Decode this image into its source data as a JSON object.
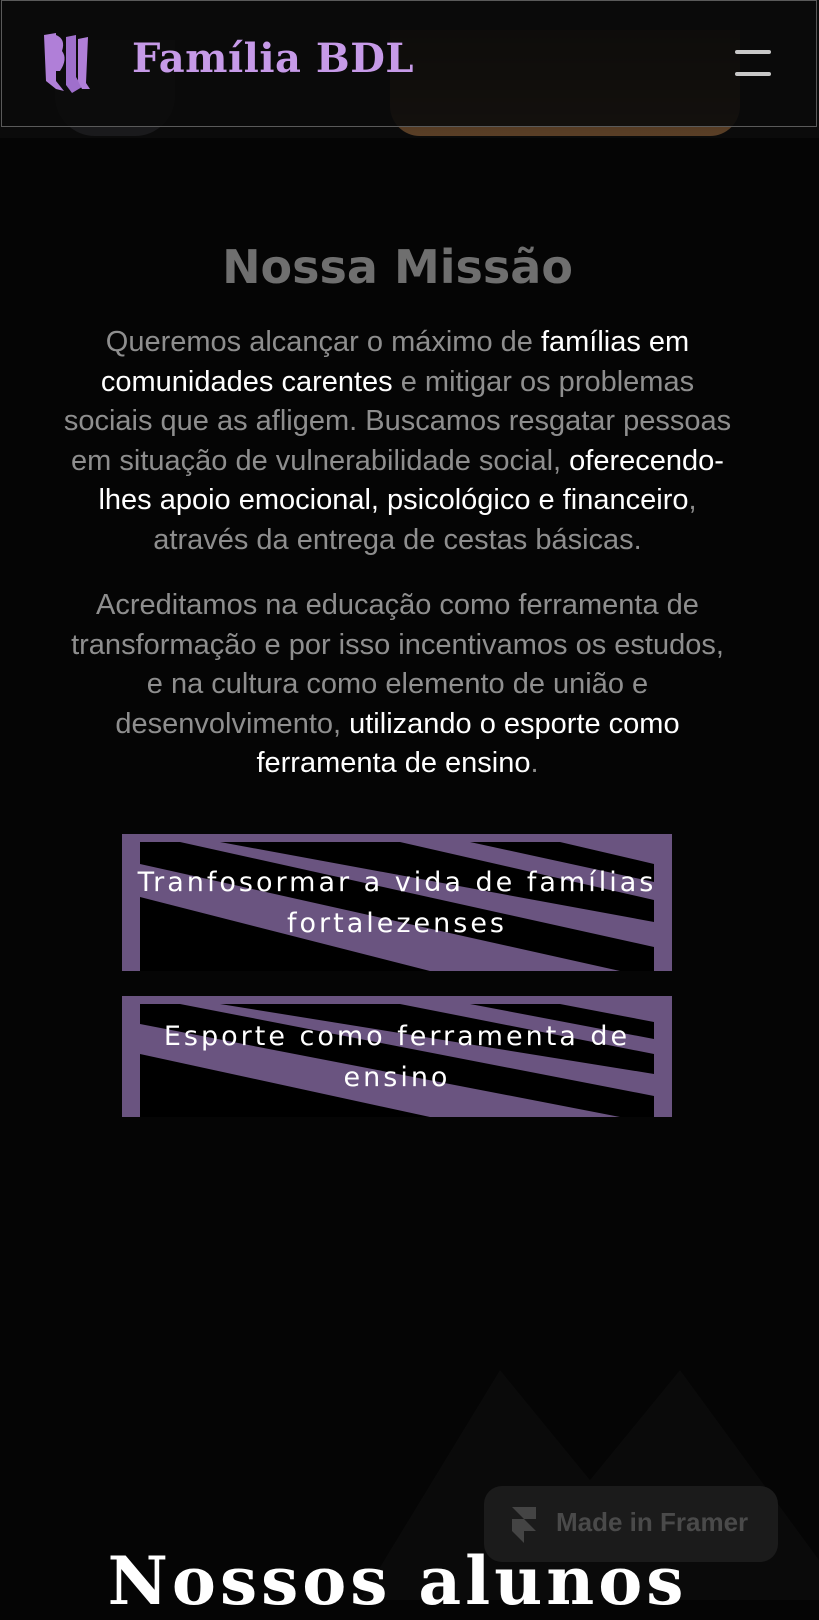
{
  "header": {
    "logo_alt": "BDL",
    "brand": "Família BDL",
    "menu_icon": "hamburger-menu-icon"
  },
  "mission": {
    "title": "Nossa Missão",
    "p1": [
      {
        "text": "Queremos alcançar o máximo de ",
        "highlight": false
      },
      {
        "text": "famílias em comunidades carentes",
        "highlight": true
      },
      {
        "text": " e mitigar os problemas sociais que as afligem. Buscamos resgatar pessoas em situação de vulnerabilidade social, ",
        "highlight": false
      },
      {
        "text": "oferecendo-lhes apoio emocional, psicológico e financeiro",
        "highlight": true
      },
      {
        "text": ", através da entrega de cestas básicas.",
        "highlight": false
      }
    ],
    "p2": [
      {
        "text": "Acreditamos na educação como ferramenta de transformação e por isso incentivamos os estudos, e na cultura como elemento de união e desenvolvimento, ",
        "highlight": false
      },
      {
        "text": "utilizando o esporte como ferramenta de ensino",
        "highlight": true
      },
      {
        "text": ".",
        "highlight": false
      }
    ]
  },
  "pills": [
    {
      "label": "Tranfosormar a vida de famílias fortalezenses"
    },
    {
      "label": "Esporte como ferramenta de ensino"
    }
  ],
  "colors": {
    "brand_purple": "#c69ae8",
    "pill_purple": "#6a5480",
    "background": "#050505"
  },
  "framer_badge": {
    "label": "Made in Framer",
    "icon": "framer-logo-icon"
  },
  "students": {
    "title": "Nossos alunos"
  }
}
